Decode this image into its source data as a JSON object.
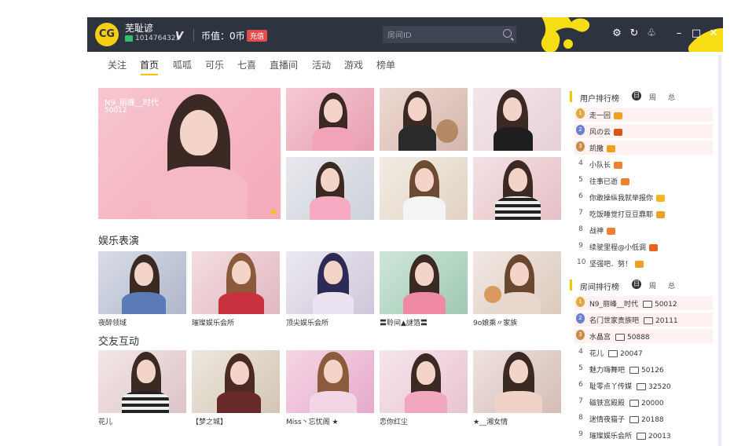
{
  "app": {
    "user_name": "芜耻谚",
    "user_id": "1014764323",
    "coin_label": "币值：0币",
    "recharge_label": "充值",
    "search_placeholder": "房间ID",
    "logo_text": "CG"
  },
  "nav": {
    "tabs": [
      "关注",
      "首页",
      "呱呱",
      "可乐",
      "七喜",
      "直播间",
      "活动",
      "游戏",
      "榜单"
    ],
    "active": "首页"
  },
  "featured": {
    "title": "N9_丽峰__时代",
    "room": "50012"
  },
  "sections": [
    {
      "title": "娱乐表演",
      "captions": [
        "夜醉领域",
        "璀璨娱乐会所",
        "顶尖娱乐会所",
        "〓聆间▲謎箔〓",
        "9o娘乘〃家族"
      ]
    },
    {
      "title": "交友互动",
      "captions": [
        "花儿",
        "【梦之城】",
        "Miss丶忘忧阁 ★",
        "恋你红尘",
        "★__湘女情"
      ]
    }
  ],
  "user_rank": {
    "title": "用户排行榜",
    "tabs": [
      "日",
      "周",
      "总"
    ],
    "items": [
      {
        "rank": "1",
        "name": "走一回"
      },
      {
        "rank": "2",
        "name": "风の云"
      },
      {
        "rank": "3",
        "name": "凯撒"
      },
      {
        "rank": "4",
        "name": "小队长"
      },
      {
        "rank": "5",
        "name": "往事已逝"
      },
      {
        "rank": "6",
        "name": "你敢操纵我就举报你"
      },
      {
        "rank": "7",
        "name": "吃饭睡觉打豆豆鼎耶"
      },
      {
        "rank": "8",
        "name": "战神"
      },
      {
        "rank": "9",
        "name": "续驶里程@小低调"
      },
      {
        "rank": "10",
        "name": "坚强吧．努！"
      }
    ]
  },
  "room_rank": {
    "title": "房间排行榜",
    "tabs": [
      "日",
      "周",
      "总"
    ],
    "items": [
      {
        "rank": "1",
        "name": "N9_丽峰__时代",
        "room": "50012"
      },
      {
        "rank": "2",
        "name": "名门世家贵族吧",
        "room": "20111"
      },
      {
        "rank": "3",
        "name": "水晶宫",
        "room": "50888"
      },
      {
        "rank": "4",
        "name": "花儿",
        "room": "20047"
      },
      {
        "rank": "5",
        "name": "魅力嗨舞吧",
        "room": "50126"
      },
      {
        "rank": "6",
        "name": "耻零点丫传媒",
        "room": "32520"
      },
      {
        "rank": "7",
        "name": "磁铁宫殿殿",
        "room": "20000"
      },
      {
        "rank": "8",
        "name": "迷情夜猫子",
        "room": "20188"
      },
      {
        "rank": "9",
        "name": "璀璨娱乐会所",
        "room": "20013"
      }
    ]
  },
  "colors": {
    "titlebar": "#2e3340",
    "accent": "#f5c400",
    "recharge": "#e84b4b"
  }
}
